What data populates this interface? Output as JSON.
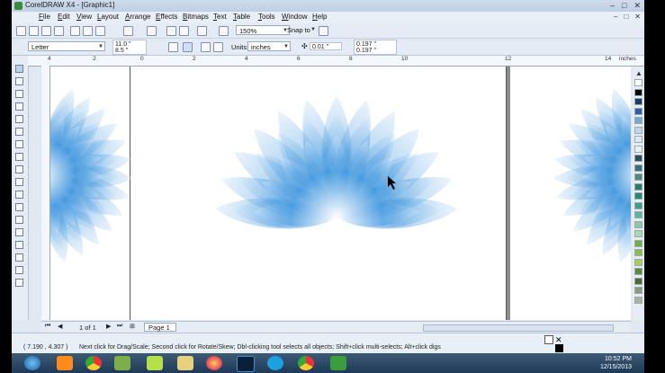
{
  "window": {
    "title": "CorelDRAW X4 - [Graphic1]",
    "controls": [
      "–",
      "□",
      "✕"
    ],
    "doc_controls": [
      "–",
      "□",
      "✕"
    ]
  },
  "menu": [
    "File",
    "Edit",
    "View",
    "Layout",
    "Arrange",
    "Effects",
    "Bitmaps",
    "Text",
    "Table",
    "Tools",
    "Window",
    "Help"
  ],
  "toolbar": {
    "zoom": "150%",
    "snap_to": "Snap to"
  },
  "property_bar": {
    "paper": "Letter",
    "width": "11.0 \"",
    "height": "8.5 \"",
    "units_label": "Units:",
    "units": "inches",
    "nudge": "0.01 \"",
    "dup_x": "0.197 \"",
    "dup_y": "0.197 \""
  },
  "ruler": {
    "labels": [
      "4",
      "2",
      "0",
      "2",
      "4",
      "6",
      "8",
      "10",
      "12",
      "14"
    ],
    "units": "inches"
  },
  "page_nav": {
    "counter": "1 of 1",
    "page_tab": "Page 1"
  },
  "status": {
    "coords": "( 7.190 , 4.307 )",
    "hint": "Next click for Drag/Scale; Second click for Rotate/Skew; Dbl-clicking tool selects all objects; Shift+click multi-selects; Alt+click digs"
  },
  "palette_colors": [
    "#ffffff",
    "#000000",
    "#1e3a6e",
    "#2f5fa8",
    "#7aa6d6",
    "#bcd6ee",
    "#dde9f6",
    "#e8f0f8",
    "#2e4a5e",
    "#3d6f7a",
    "#4a8a80",
    "#2c7a6a",
    "#1d8a7a",
    "#3aa08a",
    "#5bb8a0",
    "#8cc8a8",
    "#a8d8b0",
    "#6fae4a",
    "#8cbf4e",
    "#a8cf5a",
    "#5a8a3a",
    "#4a6a3a",
    "#8a9a7a",
    "#b0b0a0"
  ],
  "taskbar": {
    "time": "10:52 PM",
    "date": "12/15/2013"
  },
  "colors": {
    "petal_dark": "#1a7fd0",
    "petal_light": "#cfe4f7",
    "accent": "#3a8b3a"
  }
}
